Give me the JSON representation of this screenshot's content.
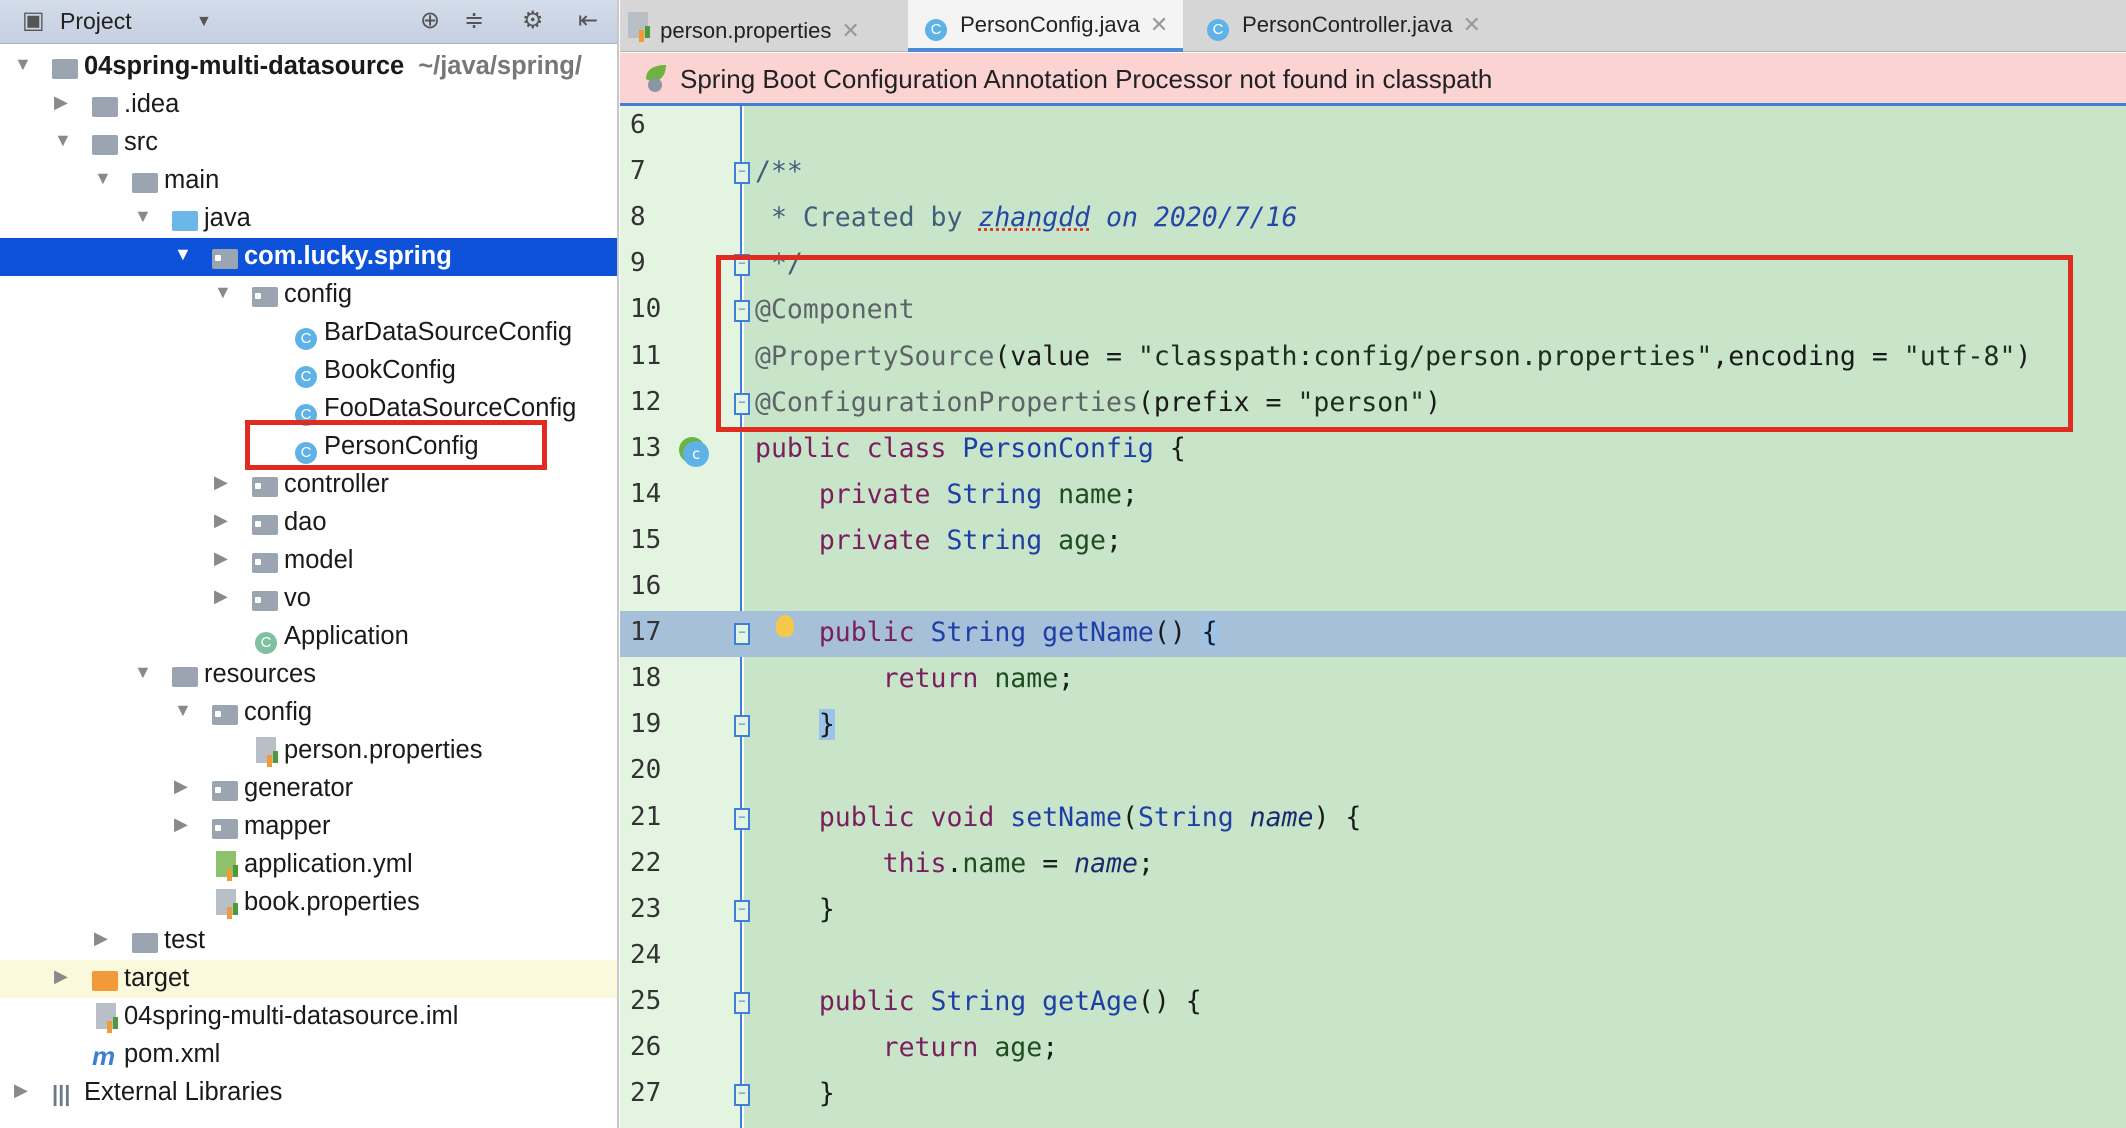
{
  "project_panel": {
    "title": "Project",
    "tree": [
      {
        "level": 0,
        "arrow": "down",
        "icon": "module-folder-icon",
        "label": "04spring-multi-datasource",
        "sub": "~/java/spring/",
        "bold": true
      },
      {
        "level": 1,
        "arrow": "right",
        "icon": "folder-icon",
        "label": ".idea"
      },
      {
        "level": 1,
        "arrow": "down",
        "icon": "folder-icon",
        "label": "src"
      },
      {
        "level": 2,
        "arrow": "down",
        "icon": "folder-icon",
        "label": "main"
      },
      {
        "level": 3,
        "arrow": "down",
        "icon": "source-folder-icon",
        "label": "java"
      },
      {
        "level": 4,
        "arrow": "down",
        "icon": "package-icon",
        "label": "com.lucky.spring",
        "selected": true,
        "bold": true
      },
      {
        "level": 5,
        "arrow": "down",
        "icon": "package-icon",
        "label": "config"
      },
      {
        "level": 6,
        "icon": "class-icon",
        "label": "BarDataSourceConfig"
      },
      {
        "level": 6,
        "icon": "class-icon",
        "label": "BookConfig"
      },
      {
        "level": 6,
        "icon": "class-icon",
        "label": "FooDataSourceConfig"
      },
      {
        "level": 6,
        "icon": "class-icon",
        "label": "PersonConfig"
      },
      {
        "level": 5,
        "arrow": "right",
        "icon": "package-icon",
        "label": "controller"
      },
      {
        "level": 5,
        "arrow": "right",
        "icon": "package-icon",
        "label": "dao"
      },
      {
        "level": 5,
        "arrow": "right",
        "icon": "package-icon",
        "label": "model"
      },
      {
        "level": 5,
        "arrow": "right",
        "icon": "package-icon",
        "label": "vo"
      },
      {
        "level": 5,
        "icon": "spring-boot-class-icon",
        "label": "Application"
      },
      {
        "level": 3,
        "arrow": "down",
        "icon": "resources-folder-icon",
        "label": "resources"
      },
      {
        "level": 4,
        "arrow": "down",
        "icon": "package-icon",
        "label": "config"
      },
      {
        "level": 5,
        "icon": "properties-file-icon",
        "label": "person.properties"
      },
      {
        "level": 4,
        "arrow": "right",
        "icon": "package-icon",
        "label": "generator"
      },
      {
        "level": 4,
        "arrow": "right",
        "icon": "package-icon",
        "label": "mapper"
      },
      {
        "level": 4,
        "icon": "yaml-file-icon",
        "label": "application.yml"
      },
      {
        "level": 4,
        "icon": "properties-file-icon",
        "label": "book.properties"
      },
      {
        "level": 2,
        "arrow": "right",
        "icon": "folder-icon",
        "label": "test"
      },
      {
        "level": 1,
        "arrow": "right",
        "icon": "excluded-folder-icon",
        "label": "target",
        "highlight": true
      },
      {
        "level": 1,
        "icon": "iml-file-icon",
        "label": "04spring-multi-datasource.iml"
      },
      {
        "level": 1,
        "icon": "maven-icon",
        "label": "pom.xml"
      },
      {
        "level": 0,
        "arrow": "right",
        "icon": "libraries-icon",
        "label": "External Libraries"
      }
    ]
  },
  "tabs": [
    {
      "label": "person.properties",
      "icon": "properties-file-icon",
      "active": false
    },
    {
      "label": "PersonConfig.java",
      "icon": "class-icon",
      "active": true
    },
    {
      "label": "PersonController.java",
      "icon": "class-icon",
      "active": false
    }
  ],
  "banner": {
    "text": "Spring Boot Configuration Annotation Processor not found in classpath"
  },
  "editor": {
    "current_line": 17,
    "lines": [
      {
        "n": "6",
        "t": []
      },
      {
        "n": "7",
        "fold": true,
        "t": [
          [
            "doc",
            "/**"
          ]
        ]
      },
      {
        "n": "8",
        "t": [
          [
            "doc",
            " * Created by "
          ],
          [
            "docu",
            "zhangdd"
          ],
          [
            "doctag",
            " on 2020/7/16"
          ]
        ]
      },
      {
        "n": "9",
        "fold": true,
        "t": [
          [
            "doc",
            " */"
          ]
        ]
      },
      {
        "n": "10",
        "fold": true,
        "t": [
          [
            "ann",
            "@Component"
          ]
        ]
      },
      {
        "n": "11",
        "t": [
          [
            "ann",
            "@PropertySource"
          ],
          [
            "plain",
            "(value = "
          ],
          [
            "str",
            "\"classpath:config/person.properties\""
          ],
          [
            "plain",
            ",encoding = "
          ],
          [
            "str",
            "\"utf-8\""
          ],
          [
            "plain",
            ")"
          ]
        ]
      },
      {
        "n": "12",
        "fold": true,
        "t": [
          [
            "ann",
            "@ConfigurationProperties"
          ],
          [
            "plain",
            "(prefix = "
          ],
          [
            "str",
            "\"person\""
          ],
          [
            "plain",
            ")"
          ]
        ]
      },
      {
        "n": "13",
        "bean": true,
        "t": [
          [
            "kw",
            "public class "
          ],
          [
            "type",
            "PersonConfig"
          ],
          [
            "plain",
            " {"
          ]
        ]
      },
      {
        "n": "14",
        "t": [
          [
            "kw",
            "    private "
          ],
          [
            "type",
            "String "
          ],
          [
            "fld",
            "name"
          ],
          [
            "plain",
            ";"
          ]
        ]
      },
      {
        "n": "15",
        "t": [
          [
            "kw",
            "    private "
          ],
          [
            "type",
            "String "
          ],
          [
            "fld",
            "age"
          ],
          [
            "plain",
            ";"
          ]
        ]
      },
      {
        "n": "16",
        "t": []
      },
      {
        "n": "17",
        "fold": true,
        "bulb": true,
        "t": [
          [
            "kw",
            "    public "
          ],
          [
            "type",
            "String getName"
          ],
          [
            "plain",
            "() "
          ],
          [
            "brace",
            "{"
          ]
        ]
      },
      {
        "n": "18",
        "t": [
          [
            "kw",
            "        return "
          ],
          [
            "fld",
            "name"
          ],
          [
            "plain",
            ";"
          ]
        ]
      },
      {
        "n": "19",
        "fold": true,
        "t": [
          [
            "plain",
            "    "
          ],
          [
            "brace",
            "}"
          ]
        ]
      },
      {
        "n": "20",
        "t": []
      },
      {
        "n": "21",
        "fold": true,
        "t": [
          [
            "kw",
            "    public void "
          ],
          [
            "type",
            "setName"
          ],
          [
            "plain",
            "("
          ],
          [
            "type",
            "String "
          ],
          [
            "par",
            "name"
          ],
          [
            "plain",
            ") {"
          ]
        ]
      },
      {
        "n": "22",
        "t": [
          [
            "kw",
            "        this"
          ],
          [
            "plain",
            "."
          ],
          [
            "fld",
            "name"
          ],
          [
            "plain",
            " = "
          ],
          [
            "par",
            "name"
          ],
          [
            "plain",
            ";"
          ]
        ]
      },
      {
        "n": "23",
        "fold": true,
        "t": [
          [
            "plain",
            "    }"
          ]
        ]
      },
      {
        "n": "24",
        "t": []
      },
      {
        "n": "25",
        "fold": true,
        "t": [
          [
            "kw",
            "    public "
          ],
          [
            "type",
            "String getAge"
          ],
          [
            "plain",
            "() {"
          ]
        ]
      },
      {
        "n": "26",
        "t": [
          [
            "kw",
            "        return "
          ],
          [
            "fld",
            "age"
          ],
          [
            "plain",
            ";"
          ]
        ]
      },
      {
        "n": "27",
        "fold": true,
        "t": [
          [
            "plain",
            "    }"
          ]
        ]
      }
    ]
  },
  "colors": {
    "selection": "#0d52d9",
    "annotation_box": "#e02b20",
    "editor_bg": "#c9e5c9",
    "banner_bg": "#fbd3d3"
  }
}
